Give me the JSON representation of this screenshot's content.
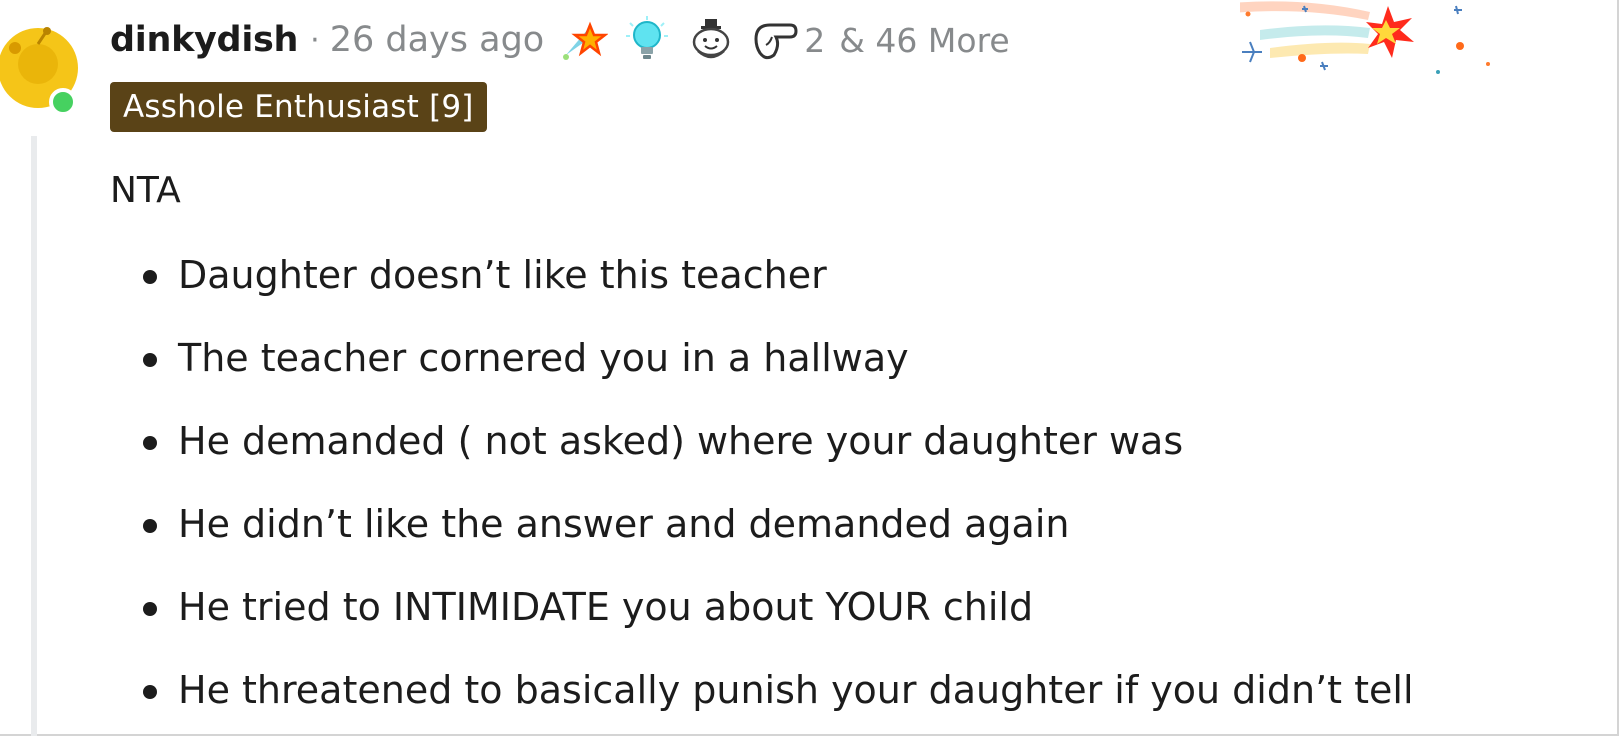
{
  "comment": {
    "username": "dinkydish",
    "separator": "·",
    "timestamp": "26 days ago",
    "awards": [
      {
        "icon": "rocket-star-award-icon"
      },
      {
        "icon": "lightbulb-award-icon"
      },
      {
        "icon": "wholesome-seal-award-icon"
      },
      {
        "icon": "pointing-hand-award-icon"
      }
    ],
    "award_count": "2",
    "more_awards": "& 46 More",
    "flair": "Asshole Enthusiast [9]",
    "verdict": "NTA",
    "points": [
      "Daughter doesn’t like this teacher",
      "The teacher cornered you in a hallway",
      "He demanded ( not asked) where your daughter was",
      "He didn’t like the answer and demanded again",
      "He tried to INTIMIDATE you about YOUR child",
      "He threatened to basically punish your daughter if you didn’t tell"
    ]
  },
  "colors": {
    "flair_bg": "#5a4317",
    "online": "#46d160",
    "avatar": "#f5c518",
    "meta_text": "#878a8c"
  },
  "icons": {
    "avatar": "snoo-avatar-icon",
    "decoration": "shooting-star-decoration-icon"
  }
}
